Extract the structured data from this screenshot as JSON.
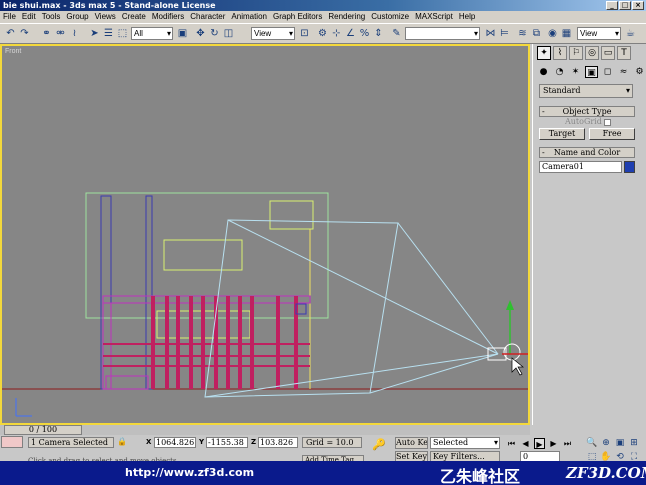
{
  "window": {
    "title": "bie shui.max - 3ds max 5 - Stand-alone License"
  },
  "menu": [
    "File",
    "Edit",
    "Tools",
    "Group",
    "Views",
    "Create",
    "Modifiers",
    "Character",
    "Animation",
    "Graph Editors",
    "Rendering",
    "Customize",
    "MAXScript",
    "Help"
  ],
  "toolbar": {
    "selection_filter": "All",
    "ref_coord": "View",
    "named_selection": "",
    "render_view": "View"
  },
  "viewport": {
    "label": "Front"
  },
  "command_panel": {
    "category": "Standard",
    "object_type_title": "Object Type",
    "autogrid_label": "AutoGrid",
    "buttons": [
      "Target",
      "Free"
    ],
    "name_color_title": "Name and Color",
    "object_name": "Camera01",
    "object_color": "#1f3fb0"
  },
  "timeline": {
    "frame_counter": "0 / 100"
  },
  "status": {
    "selection_count": "1 Camera Selected",
    "x": "1064.826",
    "y": "-1155.38",
    "z": "103.826",
    "grid": "Grid = 10.0",
    "auto_key": "Auto Key",
    "set_key": "Set Key",
    "selected_set": "Selected",
    "key_filters": "Key Filters...",
    "current_frame": "0",
    "prompt": "Click and drag to select and move objects",
    "add_time_tag": "Add Time Tag"
  },
  "banner": {
    "url": "http://www.zf3d.com",
    "logo": "乙朱峰社区",
    "brand": "ZF3D.COM"
  }
}
